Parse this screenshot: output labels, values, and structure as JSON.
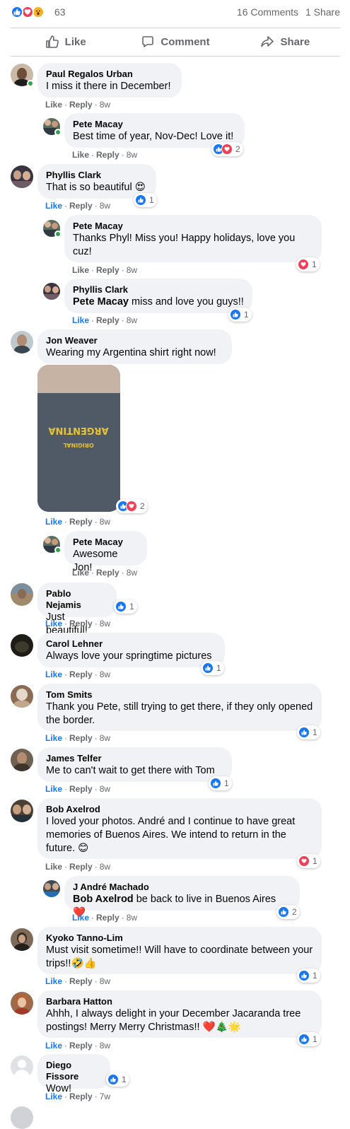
{
  "stats": {
    "reactions_count": "63",
    "comments": "16 Comments",
    "shares": "1 Share",
    "reaction_types": [
      "like-icon",
      "love-icon",
      "wow-icon"
    ]
  },
  "actions": {
    "like": "Like",
    "comment": "Comment",
    "share": "Share"
  },
  "meta_labels": {
    "like": "Like",
    "reply": "Reply",
    "separator": "·"
  },
  "colors": {
    "accent": "#1877f2",
    "love": "#f33e58",
    "bubble": "#f0f2f5",
    "muted": "#65676b"
  },
  "comments": [
    {
      "author": "Paul Regalos Urban",
      "text": "I miss it there in December!",
      "time": "8w"
    },
    {
      "author": "Pete Macay",
      "text": "Best time of year, Nov-Dec! Love it!",
      "time": "8w",
      "reactions": "2"
    },
    {
      "author": "Phyllis Clark",
      "text": "That is so beautiful 😍",
      "time": "8w",
      "reactions": "1"
    },
    {
      "author": "Pete Macay",
      "text": "Thanks Phyl! Miss you! Happy holidays, love you cuz!",
      "time": "8w",
      "reactions": "1"
    },
    {
      "author": "Phyllis Clark",
      "mention": "Pete Macay",
      "text": " miss and love you guys!!",
      "time": "8w",
      "reactions": "1"
    },
    {
      "author": "Jon Weaver",
      "text": "Wearing my Argentina shirt right now!",
      "time": "8w",
      "reactions": "2",
      "photo_text": [
        "ARGENTINA",
        "ORIGINAL"
      ]
    },
    {
      "author": "Pete Macay",
      "text": "Awesome Jon!",
      "time": "8w"
    },
    {
      "author": "Pablo Nejamis",
      "text": "Just beautiful!",
      "time": "8w",
      "reactions": "1"
    },
    {
      "author": "Carol Lehner",
      "text": "Always love your springtime pictures",
      "time": "8w",
      "reactions": "1"
    },
    {
      "author": "Tom Smits",
      "text": "Thank you Pete, still trying to get there, if they only opened the border.",
      "time": "8w",
      "reactions": "1"
    },
    {
      "author": "James Telfer",
      "text": "Me to can't wait to get there with Tom",
      "time": "8w",
      "reactions": "1"
    },
    {
      "author": "Bob Axelrod",
      "text": "I loved your photos. André and I continue to have great memories of Buenos Aires. We intend to return in the future. 😊",
      "time": "8w",
      "reactions": "1"
    },
    {
      "author": "J André Machado",
      "mention": "Bob Axelrod",
      "text": " be back to live in Buenos Aires ❤️",
      "time": "8w",
      "reactions": "2"
    },
    {
      "author": "Kyoko Tanno-Lim",
      "text": "Must visit sometime!! Will have to coordinate between your trips!!🤣👍",
      "time": "8w",
      "reactions": "1"
    },
    {
      "author": "Barbara Hatton",
      "text": "Ahhh, I always delight in your December Jacaranda tree postings! Merry Merry Christmas!! ❤️🎄🌟",
      "time": "8w",
      "reactions": "1"
    },
    {
      "author": "Diego Fissore",
      "text": "Wow!",
      "time": "7w",
      "reactions": "1"
    }
  ]
}
